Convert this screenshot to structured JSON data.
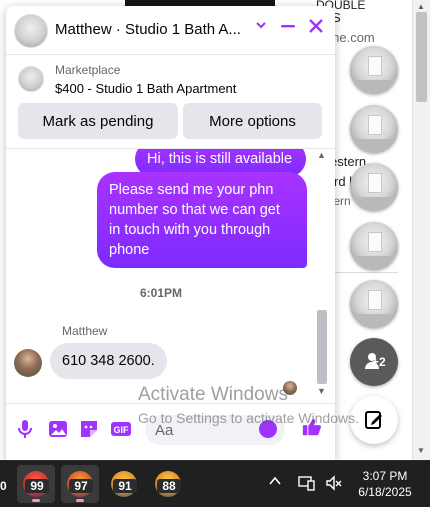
{
  "background_page": {
    "fragments": [
      "DOUBLE",
      "S",
      "uine.com",
      "estern",
      "rd l",
      "tern"
    ]
  },
  "chat": {
    "title": "Matthew · Studio 1 Bath A...",
    "icons": {
      "chevron": "chevron-down-icon",
      "minimize": "minimize-icon",
      "close": "close-icon"
    },
    "marketplace_label": "Marketplace",
    "listing": "$400 - Studio 1 Bath Apartment",
    "buttons": {
      "mark_pending": "Mark as pending",
      "more_options": "More options"
    },
    "messages": {
      "outgoing_partial": "Hi, this is still available",
      "outgoing": "Please send me your phn number so that we can get in touch with you through phone",
      "time_separator": "6:01PM",
      "sender_name": "Matthew",
      "incoming": "610 348 2600."
    },
    "composer_placeholder": "Aa",
    "accent_color": "#a033ff"
  },
  "right_rail": {
    "more_count": "+2"
  },
  "watermark": {
    "line1": "Activate Windows",
    "line2": "Go to Settings to activate Windows."
  },
  "taskbar": {
    "apps": [
      {
        "badge": "99"
      },
      {
        "badge": "97"
      },
      {
        "badge": "91"
      },
      {
        "badge": "88"
      }
    ],
    "left_edge_badge": "0",
    "clock_time": "3:07 PM",
    "clock_date": "6/18/2025"
  }
}
